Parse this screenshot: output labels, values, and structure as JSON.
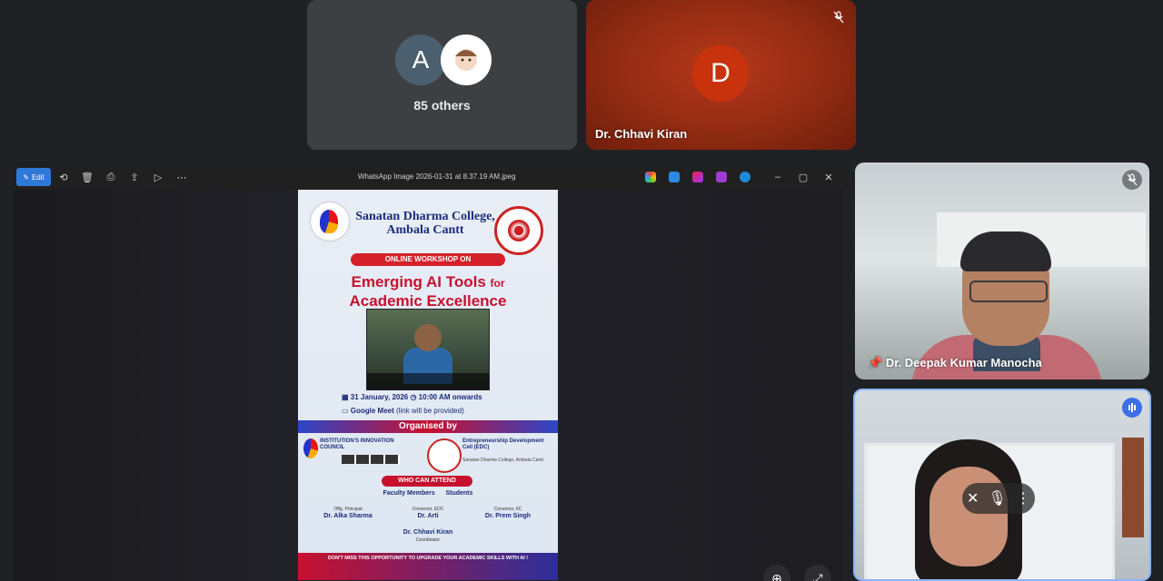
{
  "participants": {
    "others": {
      "avatar_letter": "A",
      "label": "85 others"
    },
    "chhavi": {
      "avatar_letter": "D",
      "name": "Dr. Chhavi Kiran"
    },
    "deepak": {
      "name": "Dr. Deepak Kumar Manocha"
    }
  },
  "viewer": {
    "edit_label": "Edit",
    "file_title": "WhatsApp Image 2026-01-31 at 8.37.19 AM.jpeg"
  },
  "poster": {
    "college": "Sanatan Dharma College, Ambala Cantt",
    "tag": "ONLINE WORKSHOP ON",
    "title_main": "Emerging AI Tools",
    "title_for": "for",
    "title_second": "Academic Excellence",
    "date": "31 January, 2026",
    "time": "10:00 AM onwards",
    "meet": "Google Meet",
    "meet_note": "(link will be provided)",
    "organised_by": "Organised by",
    "iic": "INSTITUTION'S INNOVATION COUNCIL",
    "edc": "Entrepreneurship Development Cell (EDC)",
    "edc_sub": "Sanatan Dharma College, Ambala Cantt.",
    "who": "WHO CAN ATTEND",
    "audience": "Faculty Members      Students",
    "sig1_role": "Offg. Principal",
    "sig1_name": "Dr. Alka Sharma",
    "sig2_role": "Convenor, EDC",
    "sig2_name": "Dr. Arti",
    "sig3_role": "Convenor, IIC",
    "sig3_name": "Dr. Prem Singh",
    "coord_name": "Dr. Chhavi Kiran",
    "coord_role": "Coordinator",
    "footer": "DON'T MISS THIS OPPORTUNITY TO UPGRADE YOUR ACADEMIC SKILLS WITH AI !"
  },
  "colors": {
    "accent": "#2f79d6",
    "meet_bg": "#202124",
    "self_border": "#8ab4f8"
  }
}
